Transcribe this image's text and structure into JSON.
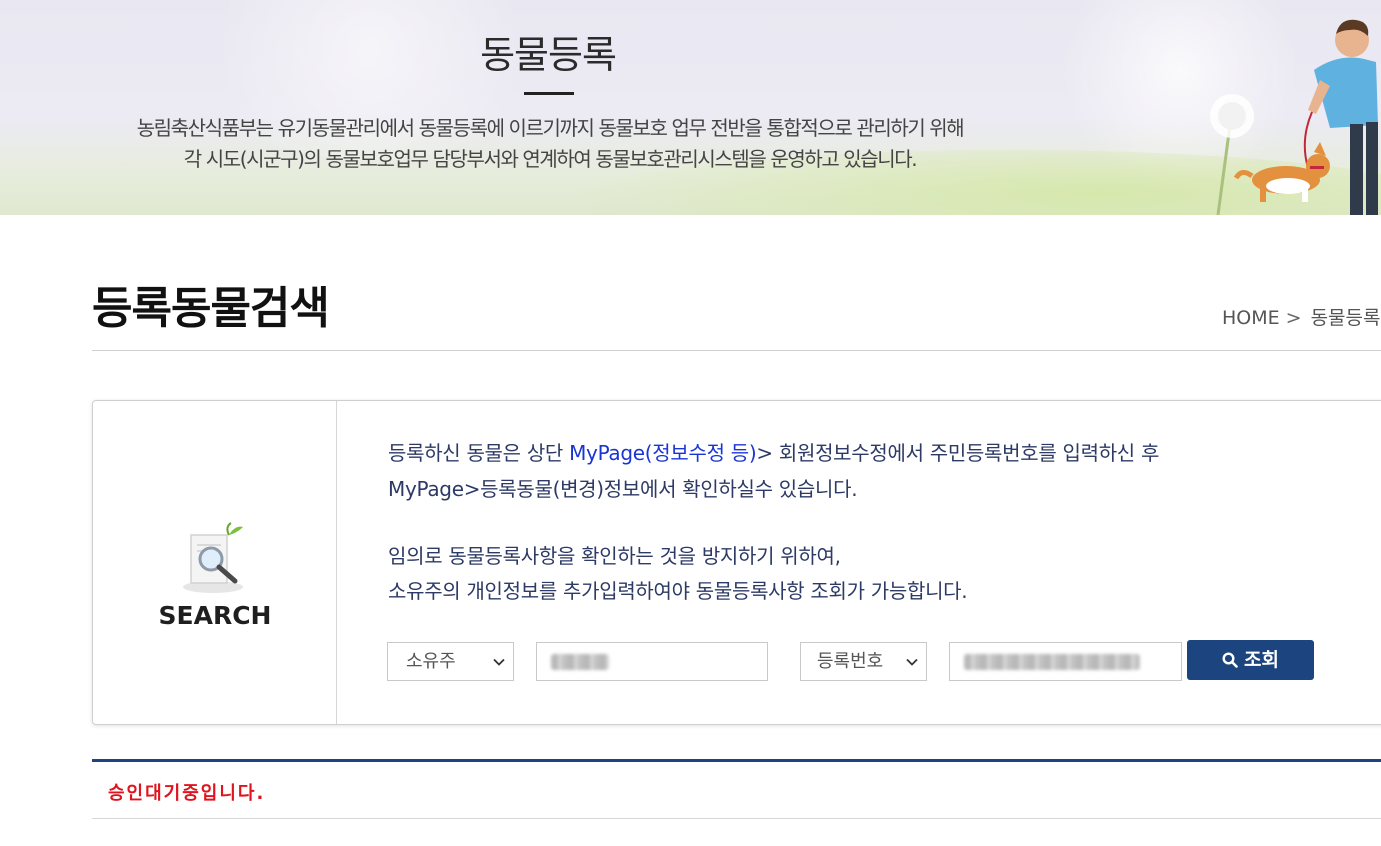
{
  "banner": {
    "title": "동물등록",
    "desc_line1": "농림축산식품부는 유기동물관리에서 동물등록에 이르기까지 동물보호 업무 전반을 통합적으로 관리하기 위해",
    "desc_line2": "각 시도(시군구)의 동물보호업무 담당부서와 연계하여 동물보호관리시스템을 운영하고 있습니다."
  },
  "page": {
    "title": "등록동물검색",
    "breadcrumb": {
      "home": "HOME",
      "separator": ">",
      "current": "동물등록"
    }
  },
  "search": {
    "label": "SEARCH",
    "icon": "magnifier-document-icon",
    "guide1_prefix": "등록하신 동물은 상단 ",
    "guide1_link": "MyPage(정보수정 등)",
    "guide1_suffix": "> 회원정보수정에서 주민등록번호를 입력하신 후",
    "guide2": "MyPage>등록동물(변경)정보에서 확인하실수 있습니다.",
    "guide3": "임의로 동물등록사항을 확인하는 것을 방지하기 위하여,",
    "guide4": "소유주의 개인정보를 추가입력하여야 동물등록사항 조회가 가능합니다.",
    "owner_select": {
      "selected": "소유주"
    },
    "owner_input": {
      "value": "(blurred)"
    },
    "reg_select": {
      "selected": "등록번호"
    },
    "reg_input": {
      "value": "(blurred)"
    },
    "button_label": "조회"
  },
  "result": {
    "message": "승인대기중입니다."
  },
  "colors": {
    "accent": "#1c457f",
    "link": "#1a35d6",
    "guide_text": "#2d3a66",
    "status_red": "#e0141e"
  }
}
